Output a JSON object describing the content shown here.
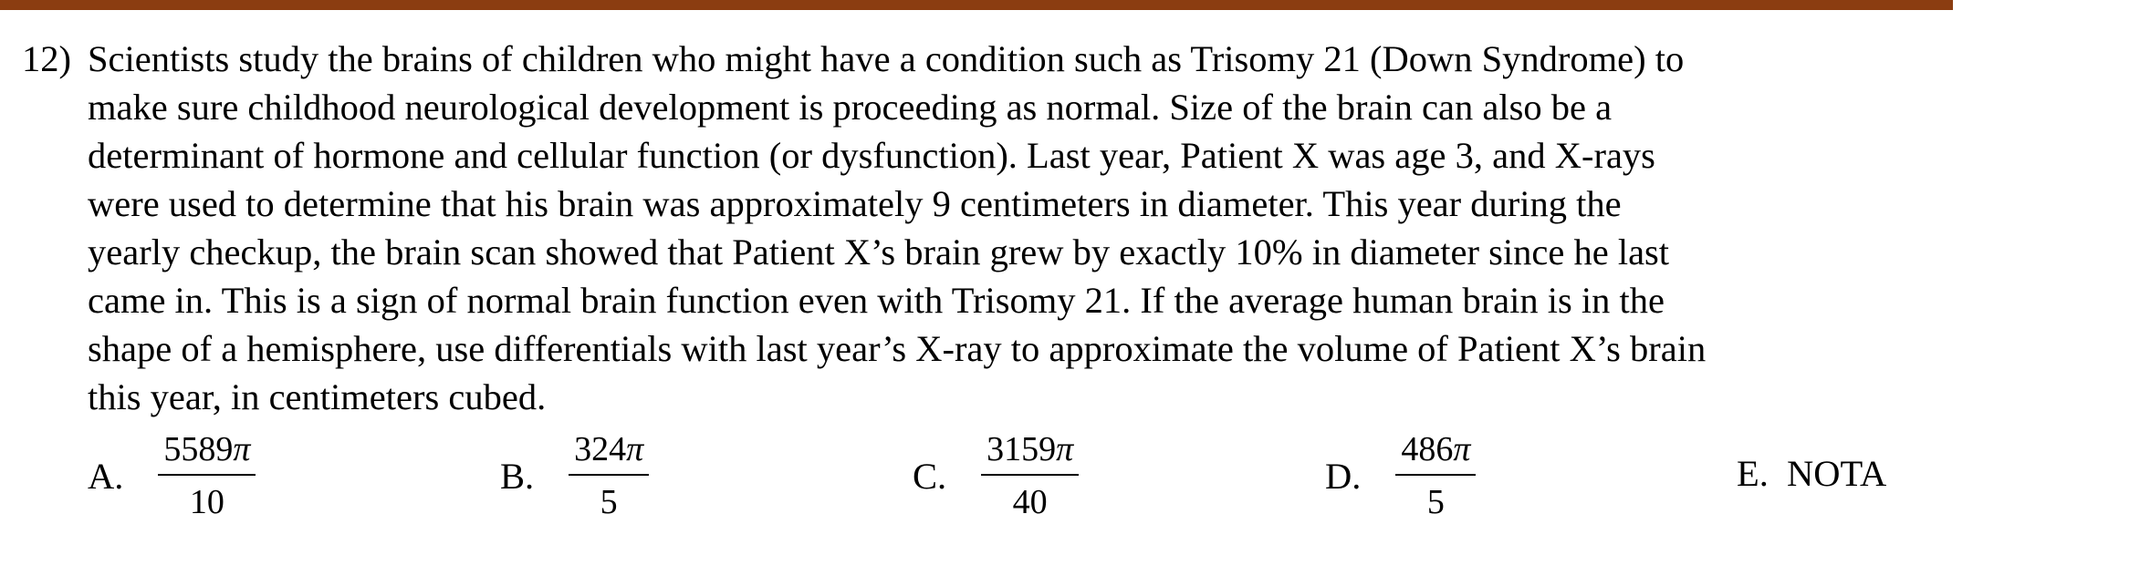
{
  "colors": {
    "top_rule": "#8b3d11",
    "text": "#000000",
    "background": "#ffffff"
  },
  "question": {
    "number": "12)",
    "lines": [
      "Scientists study the brains of children who might have a condition such as Trisomy 21 (Down Syndrome) to",
      "make sure childhood neurological development is proceeding as normal. Size of the brain can also be a",
      "determinant of hormone and cellular function (or dysfunction). Last year, Patient X was age 3, and X-rays",
      "were used to determine that his brain was approximately 9 centimeters in diameter. This year during the",
      "yearly checkup, the brain scan showed that Patient X’s brain grew by exactly 10% in diameter since he last",
      "came in. This is a sign of normal brain function even with Trisomy 21. If the average human brain is in the",
      "shape of a hemisphere, use differentials with last year’s X-ray to approximate the volume of Patient X’s brain",
      "this year, in centimeters cubed."
    ]
  },
  "choices": [
    {
      "letter": "A.",
      "numerator": "5589",
      "pi": "π",
      "denominator": "10"
    },
    {
      "letter": "B.",
      "numerator": "324",
      "pi": "π",
      "denominator": "5"
    },
    {
      "letter": "C.",
      "numerator": "3159",
      "pi": "π",
      "denominator": "40"
    },
    {
      "letter": "D.",
      "numerator": "486",
      "pi": "π",
      "denominator": "5"
    },
    {
      "letter": "E.",
      "text": "NOTA"
    }
  ]
}
